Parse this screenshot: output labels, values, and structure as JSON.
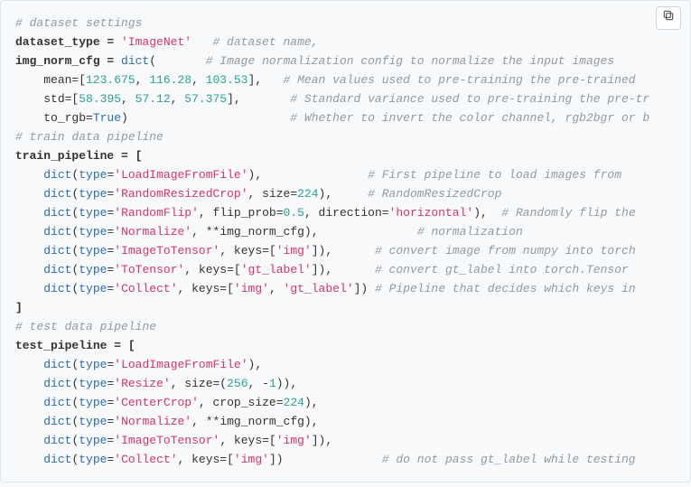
{
  "code": {
    "c1": "# dataset settings",
    "l2a": "dataset_type = ",
    "l2s": "'ImageNet'",
    "l2c": "# dataset name,",
    "l3a": "img_norm_cfg = ",
    "l3k": "dict",
    "l3p": "(",
    "l3c": "# Image normalization config to normalize the input images",
    "l4a": "mean=[",
    "l4n1": "123.675",
    "l4s1": ", ",
    "l4n2": "116.28",
    "l4s2": ", ",
    "l4n3": "103.53",
    "l4b": "],",
    "l4c": "# Mean values used to pre-training the pre-trained",
    "l5a": "std=[",
    "l5n1": "58.395",
    "l5s1": ", ",
    "l5n2": "57.12",
    "l5s2": ", ",
    "l5n3": "57.375",
    "l5b": "],",
    "l5c": "# Standard variance used to pre-training the pre-tr",
    "l6a": "to_rgb=",
    "l6k": "True",
    "l6b": ")",
    "l6c": "# Whether to invert the color channel, rgb2bgr or b",
    "c7": "# train data pipeline",
    "l8a": "train_pipeline = [",
    "tp1_a": "dict",
    "tp1_b": "(",
    "tp1_type": "type",
    "tp1_eq": "=",
    "tp1_s": "'LoadImageFromFile'",
    "tp1_end": "),",
    "tp1_c": "# First pipeline to load images from",
    "tp2_a": "dict",
    "tp2_b": "(",
    "tp2_type": "type",
    "tp2_eq": "=",
    "tp2_s": "'RandomResizedCrop'",
    "tp2_mid": ", size=",
    "tp2_n": "224",
    "tp2_end": "),",
    "tp2_c": "# RandomResizedCrop",
    "tp3_a": "dict",
    "tp3_b": "(",
    "tp3_type": "type",
    "tp3_eq": "=",
    "tp3_s": "'RandomFlip'",
    "tp3_mid1": ", flip_prob=",
    "tp3_n": "0.5",
    "tp3_mid2": ", direction=",
    "tp3_s2": "'horizontal'",
    "tp3_end": "),",
    "tp3_c": "# Randomly flip the",
    "tp4_a": "dict",
    "tp4_b": "(",
    "tp4_type": "type",
    "tp4_eq": "=",
    "tp4_s": "'Normalize'",
    "tp4_end": ", **img_norm_cfg),",
    "tp4_c": "# normalization",
    "tp5_a": "dict",
    "tp5_b": "(",
    "tp5_type": "type",
    "tp5_eq": "=",
    "tp5_s": "'ImageToTensor'",
    "tp5_mid": ", keys=[",
    "tp5_k": "'img'",
    "tp5_end": "]),",
    "tp5_c": "# convert image from numpy into torch",
    "tp6_a": "dict",
    "tp6_b": "(",
    "tp6_type": "type",
    "tp6_eq": "=",
    "tp6_s": "'ToTensor'",
    "tp6_mid": ", keys=[",
    "tp6_k": "'gt_label'",
    "tp6_end": "]),",
    "tp6_c": "# convert gt_label into torch.Tensor",
    "tp7_a": "dict",
    "tp7_b": "(",
    "tp7_type": "type",
    "tp7_eq": "=",
    "tp7_s": "'Collect'",
    "tp7_mid": ", keys=[",
    "tp7_k1": "'img'",
    "tp7_sep": ", ",
    "tp7_k2": "'gt_label'",
    "tp7_end": "])",
    "tp7_c": "# Pipeline that decides which keys in",
    "lclose": "]",
    "c_test": "# test data pipeline",
    "ltest": "test_pipeline = [",
    "te1_a": "dict",
    "te1_b": "(",
    "te1_type": "type",
    "te1_eq": "=",
    "te1_s": "'LoadImageFromFile'",
    "te1_end": "),",
    "te2_a": "dict",
    "te2_b": "(",
    "te2_type": "type",
    "te2_eq": "=",
    "te2_s": "'Resize'",
    "te2_mid": ", size=(",
    "te2_n1": "256",
    "te2_sep": ", -",
    "te2_n2": "1",
    "te2_end": ")),",
    "te3_a": "dict",
    "te3_b": "(",
    "te3_type": "type",
    "te3_eq": "=",
    "te3_s": "'CenterCrop'",
    "te3_mid": ", crop_size=",
    "te3_n": "224",
    "te3_end": "),",
    "te4_a": "dict",
    "te4_b": "(",
    "te4_type": "type",
    "te4_eq": "=",
    "te4_s": "'Normalize'",
    "te4_end": ", **img_norm_cfg),",
    "te5_a": "dict",
    "te5_b": "(",
    "te5_type": "type",
    "te5_eq": "=",
    "te5_s": "'ImageToTensor'",
    "te5_mid": ", keys=[",
    "te5_k": "'img'",
    "te5_end": "]),",
    "te6_a": "dict",
    "te6_b": "(",
    "te6_type": "type",
    "te6_eq": "=",
    "te6_s": "'Collect'",
    "te6_mid": ", keys=[",
    "te6_k": "'img'",
    "te6_end": "])",
    "te6_c": "# do not pass gt_label while testing"
  }
}
